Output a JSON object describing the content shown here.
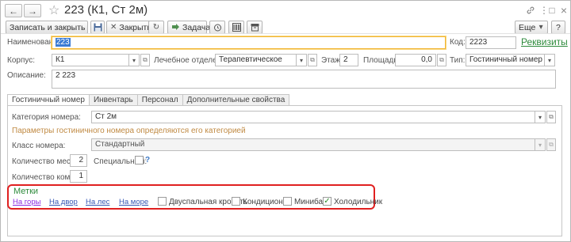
{
  "title": "223 (К1, Ст 2м)",
  "toolbar": {
    "save_close": "Записать и закрыть",
    "close": "Закрыть",
    "task": "Задача",
    "more": "Еще",
    "help": "?"
  },
  "form": {
    "name_label": "Наименование:",
    "name_value": "223",
    "code_label": "Код:",
    "code_value": "2223",
    "requisites_link": "Реквизиты",
    "building_label": "Корпус:",
    "building_value": "К1",
    "department_label": "Лечебное отделение:",
    "department_value": "Терапевтическое",
    "floor_label": "Этаж:",
    "floor_value": "2",
    "area_label": "Площадь:",
    "area_value": "0,0",
    "type_label": "Тип:",
    "type_value": "Гостиничный номер",
    "description_label": "Описание:",
    "description_value": "2 223"
  },
  "tabs": [
    "Гостиничный номер",
    "Инвентарь",
    "Персонал",
    "Дополнительные свойства"
  ],
  "room": {
    "category_label": "Категория номера:",
    "category_value": "Ст 2м",
    "hint": "Параметры гостиничного номера определяются его категорией",
    "class_label": "Класс номера:",
    "class_value": "Стандартный",
    "beds_label": "Количество мест:",
    "beds_value": "2",
    "special_label": "Специальный:",
    "special_help": "?",
    "rooms_label": "Количество комнат:",
    "rooms_value": "1"
  },
  "tags": {
    "title": "Метки",
    "links": [
      "На горы",
      "На двор",
      "На лес",
      "На море"
    ],
    "checkboxes": [
      {
        "label": "Двуспальная кровать",
        "checked": false
      },
      {
        "label": "Кондиционер",
        "checked": false
      },
      {
        "label": "Минибар",
        "checked": false
      },
      {
        "label": "Холодильник",
        "checked": true
      }
    ],
    "check_mark": "✓"
  },
  "colors": {
    "highlight_border": "#e02020",
    "link_green": "#2e8b3c",
    "focus_border": "#f1b534",
    "hint": "#c08a43"
  },
  "icons": {
    "back": "←",
    "forward": "→",
    "star": "☆",
    "link": "🔗",
    "menu": "⋮",
    "maximize": "□",
    "close": "×",
    "save": "💾",
    "close_doc": "✕",
    "history": "↻",
    "alarm": "⏰",
    "barcode": "▦",
    "archive": "▤",
    "dropdown": "▾",
    "open": "⧉"
  }
}
